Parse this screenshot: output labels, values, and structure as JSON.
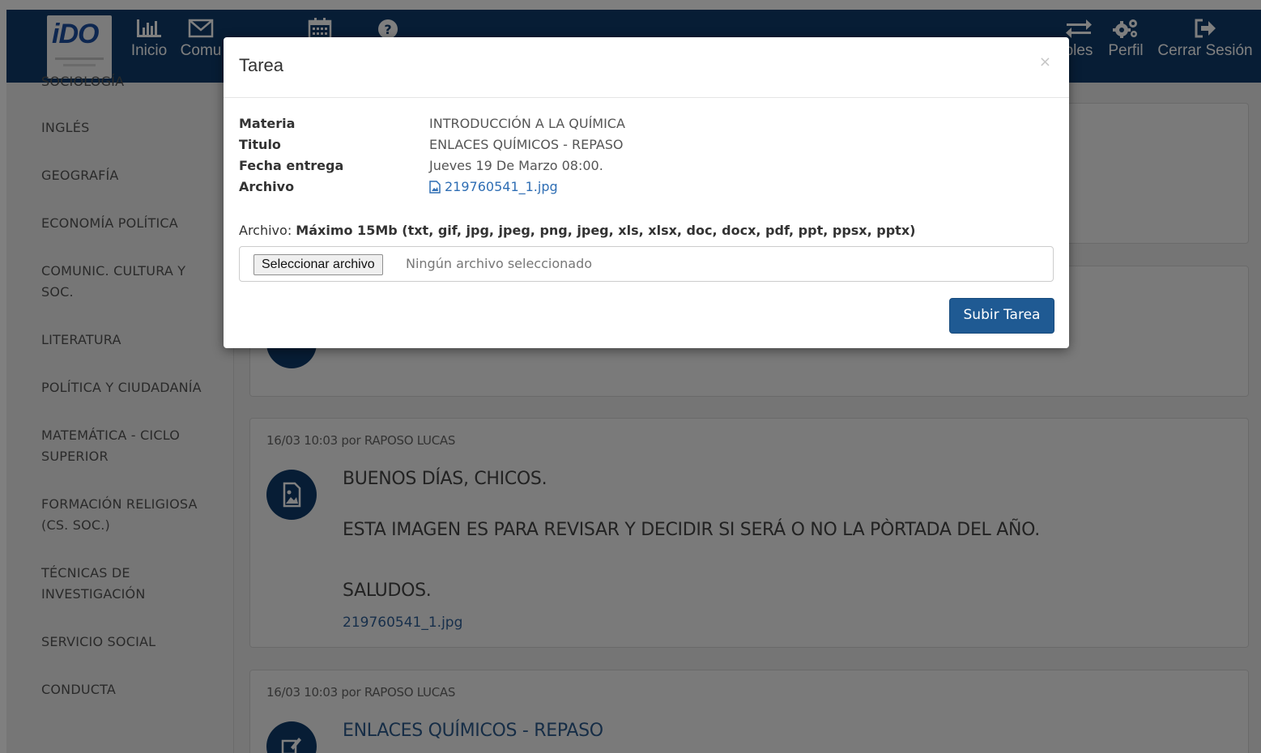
{
  "nav": {
    "logo_text": "iDO",
    "items": [
      {
        "label": "Inicio",
        "icon": "bar-chart-icon"
      },
      {
        "label": "Comu",
        "icon": "envelope-icon"
      },
      {
        "label": "",
        "icon": "calendar-icon"
      },
      {
        "label": "",
        "icon": "help-icon"
      },
      {
        "label": "bles",
        "icon": "swap-icon"
      },
      {
        "label": "Perfil",
        "icon": "gears-icon"
      },
      {
        "label": "Cerrar Sesión",
        "icon": "sign-out-icon"
      }
    ]
  },
  "sidebar": {
    "items": [
      {
        "label": "SOCIOLOGÍA"
      },
      {
        "label": "INGLÉS"
      },
      {
        "label": "GEOGRAFÍA"
      },
      {
        "label": "ECONOMÍA POLÍTICA"
      },
      {
        "label": "COMUNIC. CULTURA Y SOC."
      },
      {
        "label": "LITERATURA"
      },
      {
        "label": "POLÍTICA Y CIUDADANÍA"
      },
      {
        "label": "MATEMÁTICA - CICLO SUPERIOR"
      },
      {
        "label": "FORMACIÓN RELIGIOSA (CS. SOC.)"
      },
      {
        "label": "TÉCNICAS DE INVESTIGACIÓN"
      },
      {
        "label": "SERVICIO SOCIAL"
      },
      {
        "label": "CONDUCTA"
      }
    ]
  },
  "posts": [
    {
      "meta": "16/03 10:03 por RAPOSO LUCAS",
      "icon": "image-icon",
      "lines": [
        "BUENOS DÍAS, CHICOS.",
        "ESTA IMAGEN ES PARA REVISAR Y DECIDIR SI SERÁ O NO LA PÒRTADA DEL AÑO.",
        "SALUDOS."
      ],
      "link": "219760541_1.jpg"
    },
    {
      "meta": "16/03 10:03 por RAPOSO LUCAS",
      "icon": "edit-icon",
      "title": "ENLACES QUÍMICOS - REPASO"
    }
  ],
  "modal": {
    "title": "Tarea",
    "close": "×",
    "rows": [
      {
        "label": "Materia",
        "value": "INTRODUCCIÓN A LA QUÍMICA"
      },
      {
        "label": "Titulo",
        "value": "ENLACES QUÍMICOS - REPASO"
      },
      {
        "label": "Fecha entrega",
        "value": "Jueves 19 De Marzo 08:00."
      },
      {
        "label": "Archivo",
        "value": "219760541_1.jpg"
      }
    ],
    "upload_prefix": "Archivo: ",
    "upload_rules": "Máximo 15Mb (txt, gif, jpg, jpeg, png, jpeg, xls, xlsx, doc, docx, pdf, ppt, ppsx, pptx)",
    "file_button": "Seleccionar archivo",
    "file_none": "Ningún archivo seleccionado",
    "submit": "Subir Tarea"
  },
  "colors": {
    "nav_bg": "#0e3b6a",
    "primary_button": "#1f5a93",
    "link": "#2f6eb4"
  }
}
